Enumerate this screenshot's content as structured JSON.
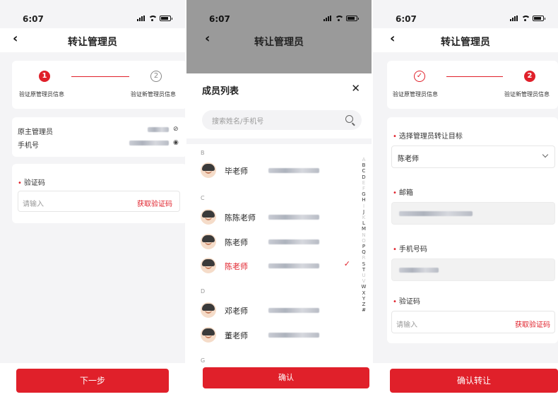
{
  "status": {
    "time": "6:07"
  },
  "screen1": {
    "nav": {
      "back_icon": "chevron-left",
      "title": "转让管理员"
    },
    "steps": [
      {
        "number": "1",
        "label": "验证原管理员信息",
        "state": "active"
      },
      {
        "number": "2",
        "label": "验证新管理员信息",
        "state": "pending"
      }
    ],
    "info": {
      "admin_label": "原主管理员",
      "phone_label": "手机号",
      "admin_eye_icon": "eye-off-icon",
      "phone_eye_icon": "eye-icon"
    },
    "code": {
      "label": "验证码",
      "placeholder": "请输入",
      "get_code": "获取验证码"
    },
    "next_button": "下一步"
  },
  "screen2": {
    "nav": {
      "back_icon": "chevron-left",
      "title": "转让管理员"
    },
    "sheet_title": "成员列表",
    "close_icon": "close-icon",
    "search_placeholder": "搜索姓名/手机号",
    "groups": [
      {
        "letter": "B",
        "members": [
          {
            "name": "毕老师",
            "selected": false
          }
        ]
      },
      {
        "letter": "C",
        "members": [
          {
            "name": "陈陈老师",
            "selected": false
          },
          {
            "name": "陈老师",
            "selected": false
          },
          {
            "name": "陈老师",
            "selected": true
          }
        ]
      },
      {
        "letter": "D",
        "members": [
          {
            "name": "邓老师",
            "selected": false
          },
          {
            "name": "董老师",
            "selected": false
          }
        ]
      },
      {
        "letter": "G",
        "members": []
      }
    ],
    "alphabet": [
      "A",
      "B",
      "C",
      "D",
      "E",
      "F",
      "G",
      "H",
      "I",
      "J",
      "K",
      "L",
      "M",
      "N",
      "O",
      "P",
      "Q",
      "R",
      "S",
      "T",
      "U",
      "V",
      "W",
      "X",
      "Y",
      "Z",
      "#"
    ],
    "alphabet_active": [
      "B",
      "C",
      "D",
      "G",
      "H",
      "J",
      "L",
      "M",
      "P",
      "Q",
      "S",
      "T",
      "W",
      "X",
      "Y",
      "Z",
      "#"
    ],
    "confirm_button": "确认"
  },
  "screen3": {
    "nav": {
      "back_icon": "chevron-left",
      "title": "转让管理员"
    },
    "steps": [
      {
        "number": "✓",
        "label": "验证原管理员信息",
        "state": "done"
      },
      {
        "number": "2",
        "label": "验证新管理员信息",
        "state": "active"
      }
    ],
    "target": {
      "label": "选择管理员转让目标",
      "value": "陈老师"
    },
    "email": {
      "label": "邮箱"
    },
    "phone": {
      "label": "手机号码"
    },
    "code": {
      "label": "验证码",
      "placeholder": "请输入",
      "get_code": "获取验证码"
    },
    "confirm_button": "确认转让"
  },
  "colors": {
    "accent": "#e0202a",
    "background": "#f4f4f6"
  }
}
